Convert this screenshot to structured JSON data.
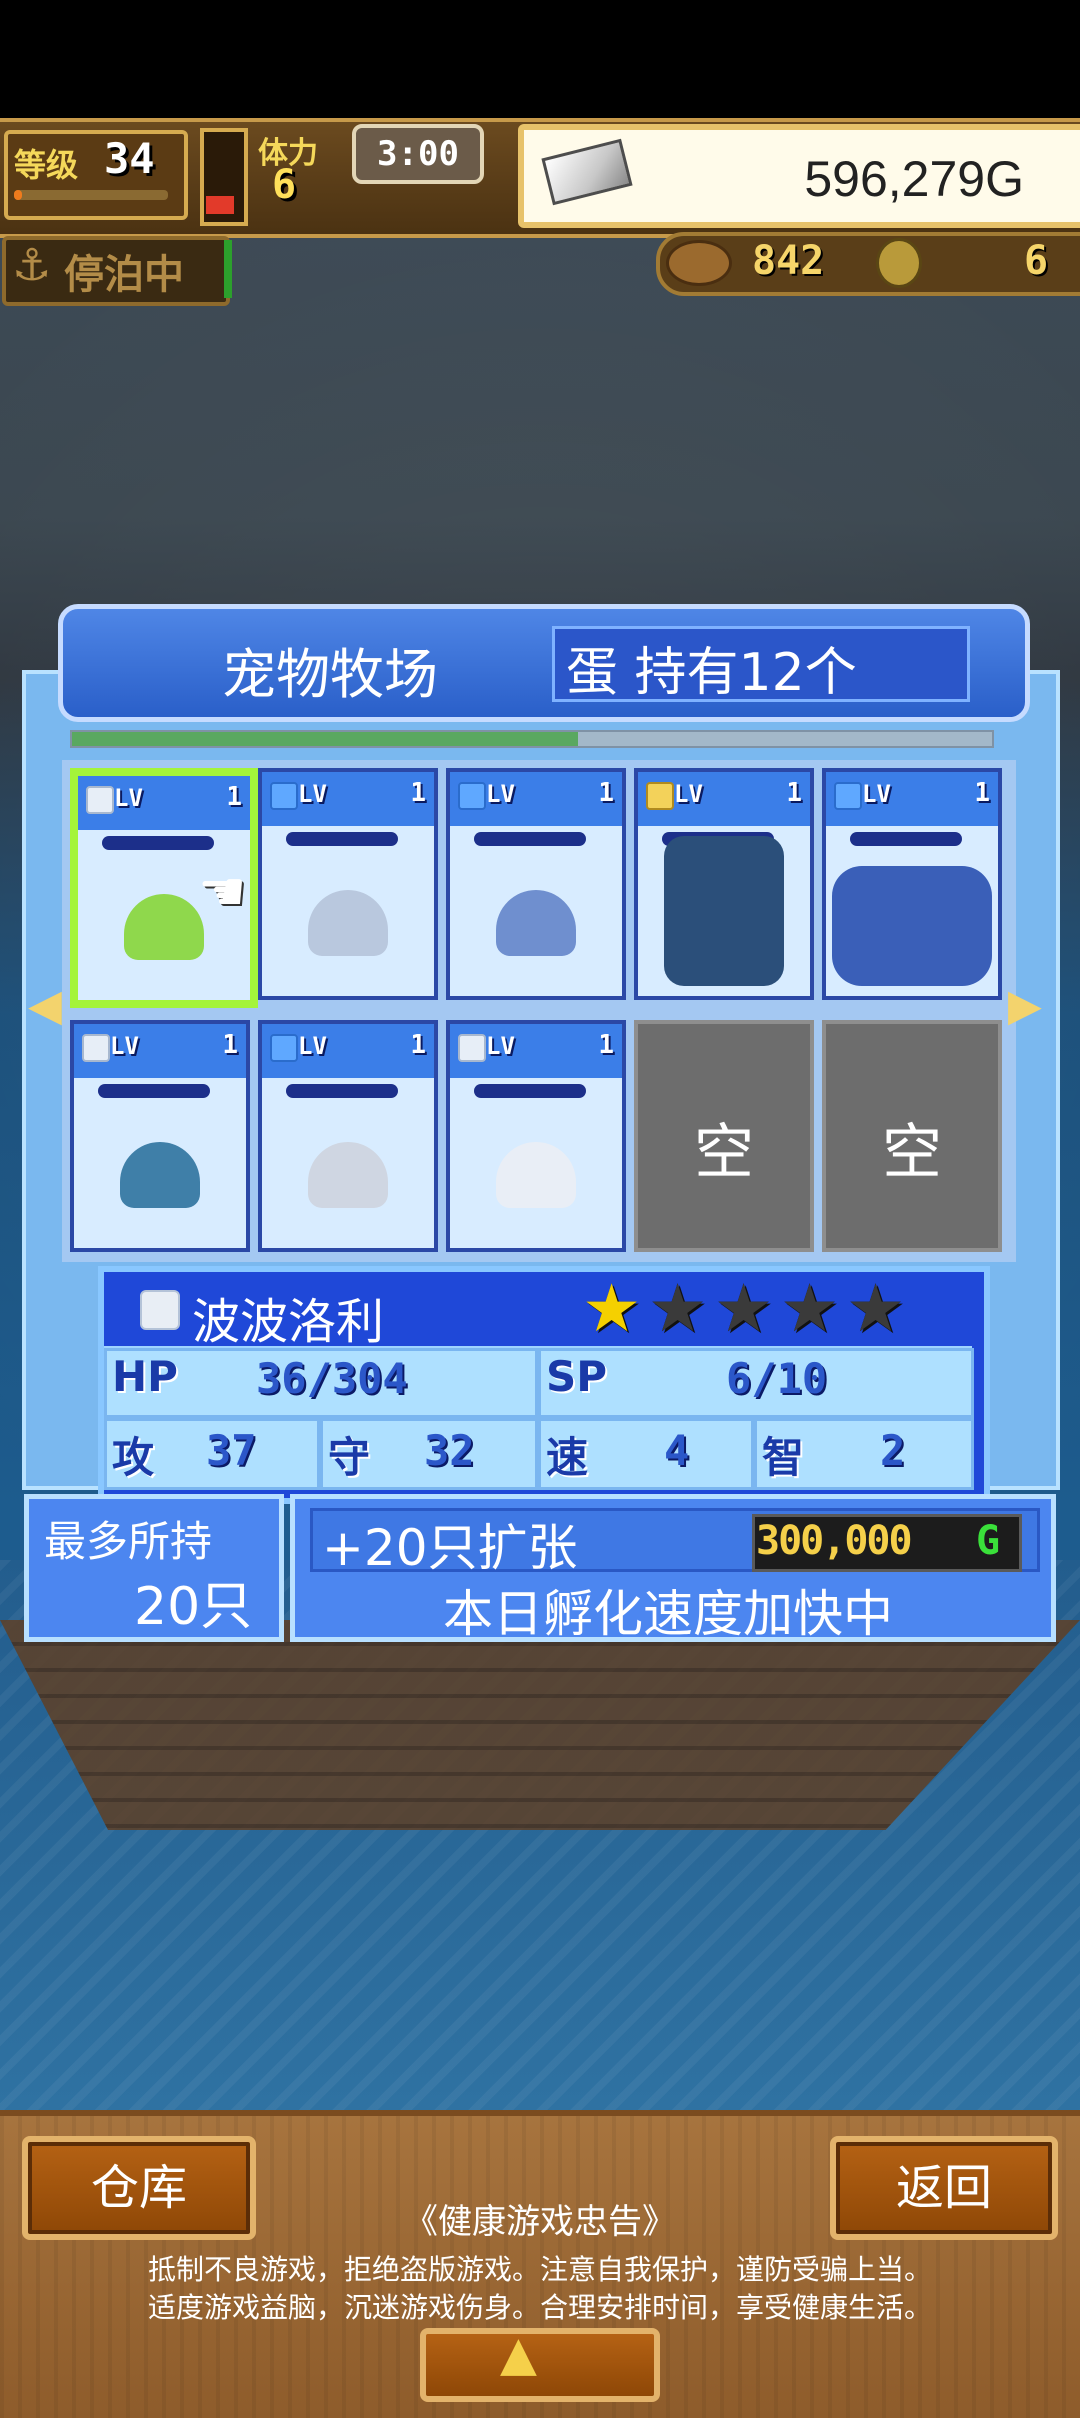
{
  "status": {
    "level_label": "等级",
    "level_value": "34",
    "stamina_label": "体力",
    "stamina_value": "6",
    "timer": "3:00",
    "gold": "596,279G",
    "dock_label": "停泊中",
    "wood_value": "842",
    "medal_value": "6"
  },
  "panel": {
    "title": "宠物牧场",
    "eggs_label": "蛋 持有12个",
    "progress": 0.55
  },
  "slots": [
    {
      "lv_label": "LV",
      "lv": "1",
      "sprite_color": "#8fd84c"
    },
    {
      "lv_label": "LV",
      "lv": "1",
      "sprite_color": "#b9c8de"
    },
    {
      "lv_label": "LV",
      "lv": "1",
      "sprite_color": "#6f8fcf"
    },
    {
      "lv_label": "LV",
      "lv": "1",
      "sprite_color": "#2b4f7a"
    },
    {
      "lv_label": "LV",
      "lv": "1",
      "sprite_color": "#3a5fb8"
    },
    {
      "lv_label": "LV",
      "lv": "1",
      "sprite_color": "#3f7fa8"
    },
    {
      "lv_label": "LV",
      "lv": "1",
      "sprite_color": "#cfd6e2"
    },
    {
      "lv_label": "LV",
      "lv": "1",
      "sprite_color": "#e9eef6"
    }
  ],
  "empty_slots": [
    "空",
    "空"
  ],
  "pet": {
    "name": "波波洛利",
    "stars_filled": 1,
    "stars_total": 5,
    "hp_label": "HP",
    "hp_value": "36/304",
    "sp_label": "SP",
    "sp_value": "6/10",
    "atk_label": "攻",
    "atk_value": "37",
    "def_label": "守",
    "def_value": "32",
    "spd_label": "速",
    "spd_value": "4",
    "int_label": "智",
    "int_value": "2"
  },
  "capacity": {
    "label": "最多所持",
    "value": "20只"
  },
  "expand": {
    "label": "+20只扩张",
    "price": "300,000",
    "currency": "G",
    "boost": "本日孵化速度加快中"
  },
  "bottom": {
    "warehouse": "仓库",
    "back": "返回",
    "notice_title": "《健康游戏忠告》",
    "notice_line_1": "抵制不良游戏，拒绝盗版游戏。注意自我保护，谨防受骗上当。",
    "notice_line_2": "适度游戏益脑，沉迷游戏伤身。合理安排时间，享受健康生活。"
  },
  "colors": {
    "accent": "#2a5fc9",
    "selection": "#a4f43a",
    "star_filled": "#f5d000",
    "star_empty": "#3a3a3a"
  }
}
